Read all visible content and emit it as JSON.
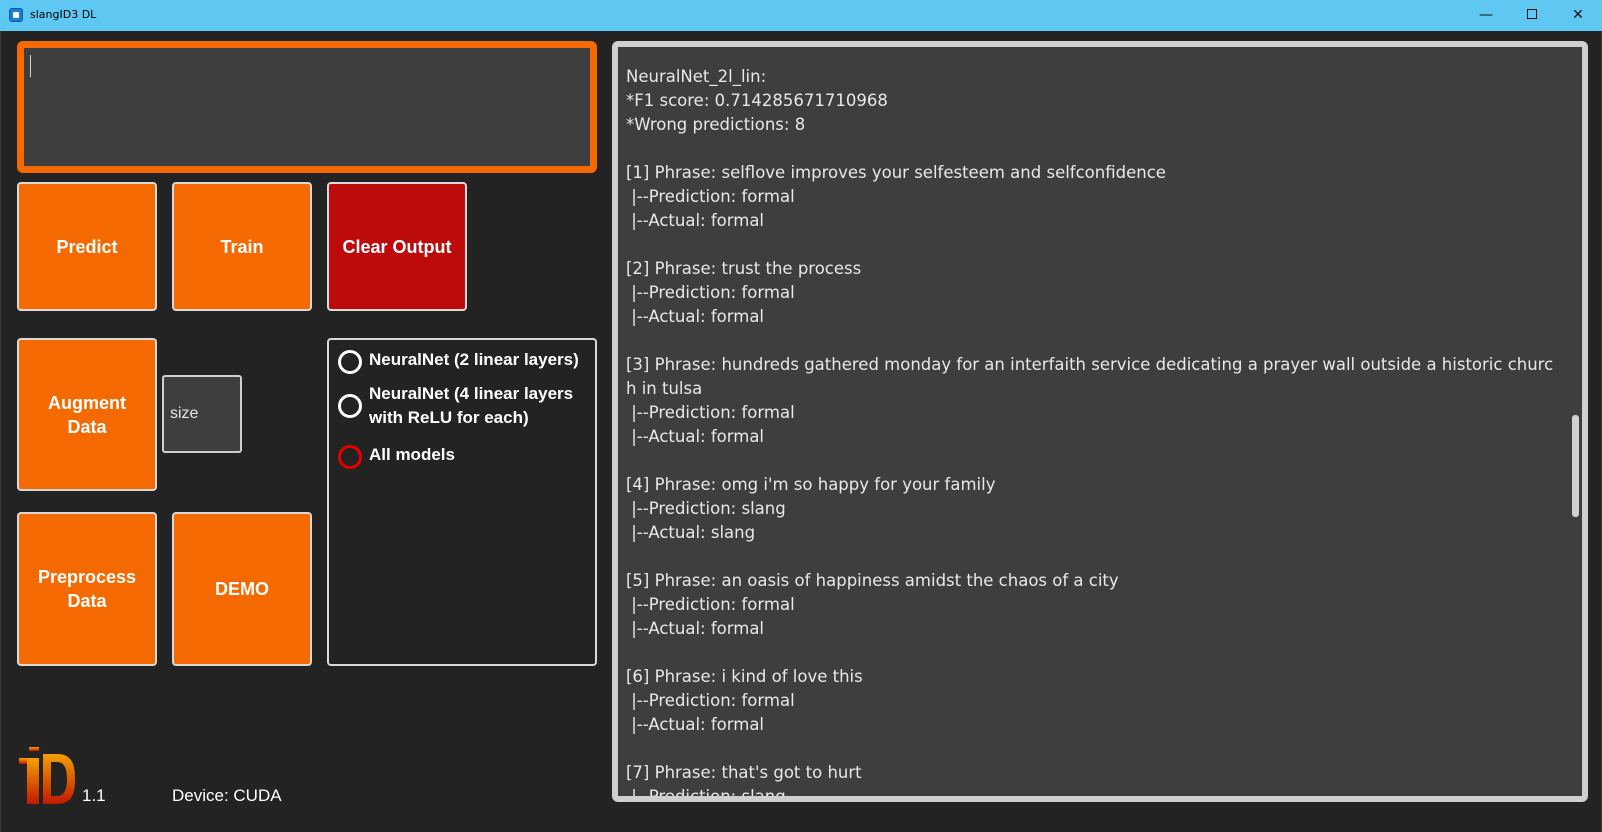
{
  "window": {
    "title": "slangID3 DL",
    "minimize": "—",
    "close": "✕"
  },
  "input": {
    "value": ""
  },
  "buttons": {
    "predict": "Predict",
    "train": "Train",
    "clear_output": "Clear Output",
    "augment_data_l1": "Augment",
    "augment_data_l2": "Data",
    "preprocess_data_l1": "Preprocess",
    "preprocess_data_l2": "Data",
    "demo": "DEMO"
  },
  "size_field": {
    "placeholder": "size"
  },
  "models": [
    {
      "label_l1": "NeuralNet (2 linear layers)",
      "label_l2": "",
      "selected": false
    },
    {
      "label_l1": "NeuralNet (4 linear layers",
      "label_l2": "with ReLU for each)",
      "selected": false
    },
    {
      "label_l1": "All models",
      "label_l2": "",
      "selected": true
    }
  ],
  "footer": {
    "version": "1.1",
    "device": "Device: CUDA",
    "logo_text": "iD"
  },
  "output": {
    "lines": [
      "NeuralNet_2l_lin:",
      "*F1 score: 0.714285671710968",
      "*Wrong predictions: 8",
      "",
      "[1] Phrase: selflove improves your selfesteem and selfconfidence",
      " |--Prediction: formal",
      " |--Actual: formal",
      "",
      "[2] Phrase: trust the process",
      " |--Prediction: formal",
      " |--Actual: formal",
      "",
      "[3] Phrase: hundreds gathered monday for an interfaith service dedicating a prayer wall outside a historic churc",
      "h in tulsa",
      " |--Prediction: formal",
      " |--Actual: formal",
      "",
      "[4] Phrase: omg i'm so happy for your family",
      " |--Prediction: slang",
      " |--Actual: slang",
      "",
      "[5] Phrase: an oasis of happiness amidst the chaos of a city",
      " |--Prediction: formal",
      " |--Actual: formal",
      "",
      "[6] Phrase: i kind of love this",
      " |--Prediction: formal",
      " |--Actual: formal",
      "",
      "[7] Phrase: that's got to hurt",
      " |--Prediction: slang"
    ]
  },
  "colors": {
    "accent": "#f56a00",
    "danger": "#bd0a0a",
    "titlebar": "#5ec8f2",
    "panel": "#3e3e3e",
    "background": "#232323"
  }
}
